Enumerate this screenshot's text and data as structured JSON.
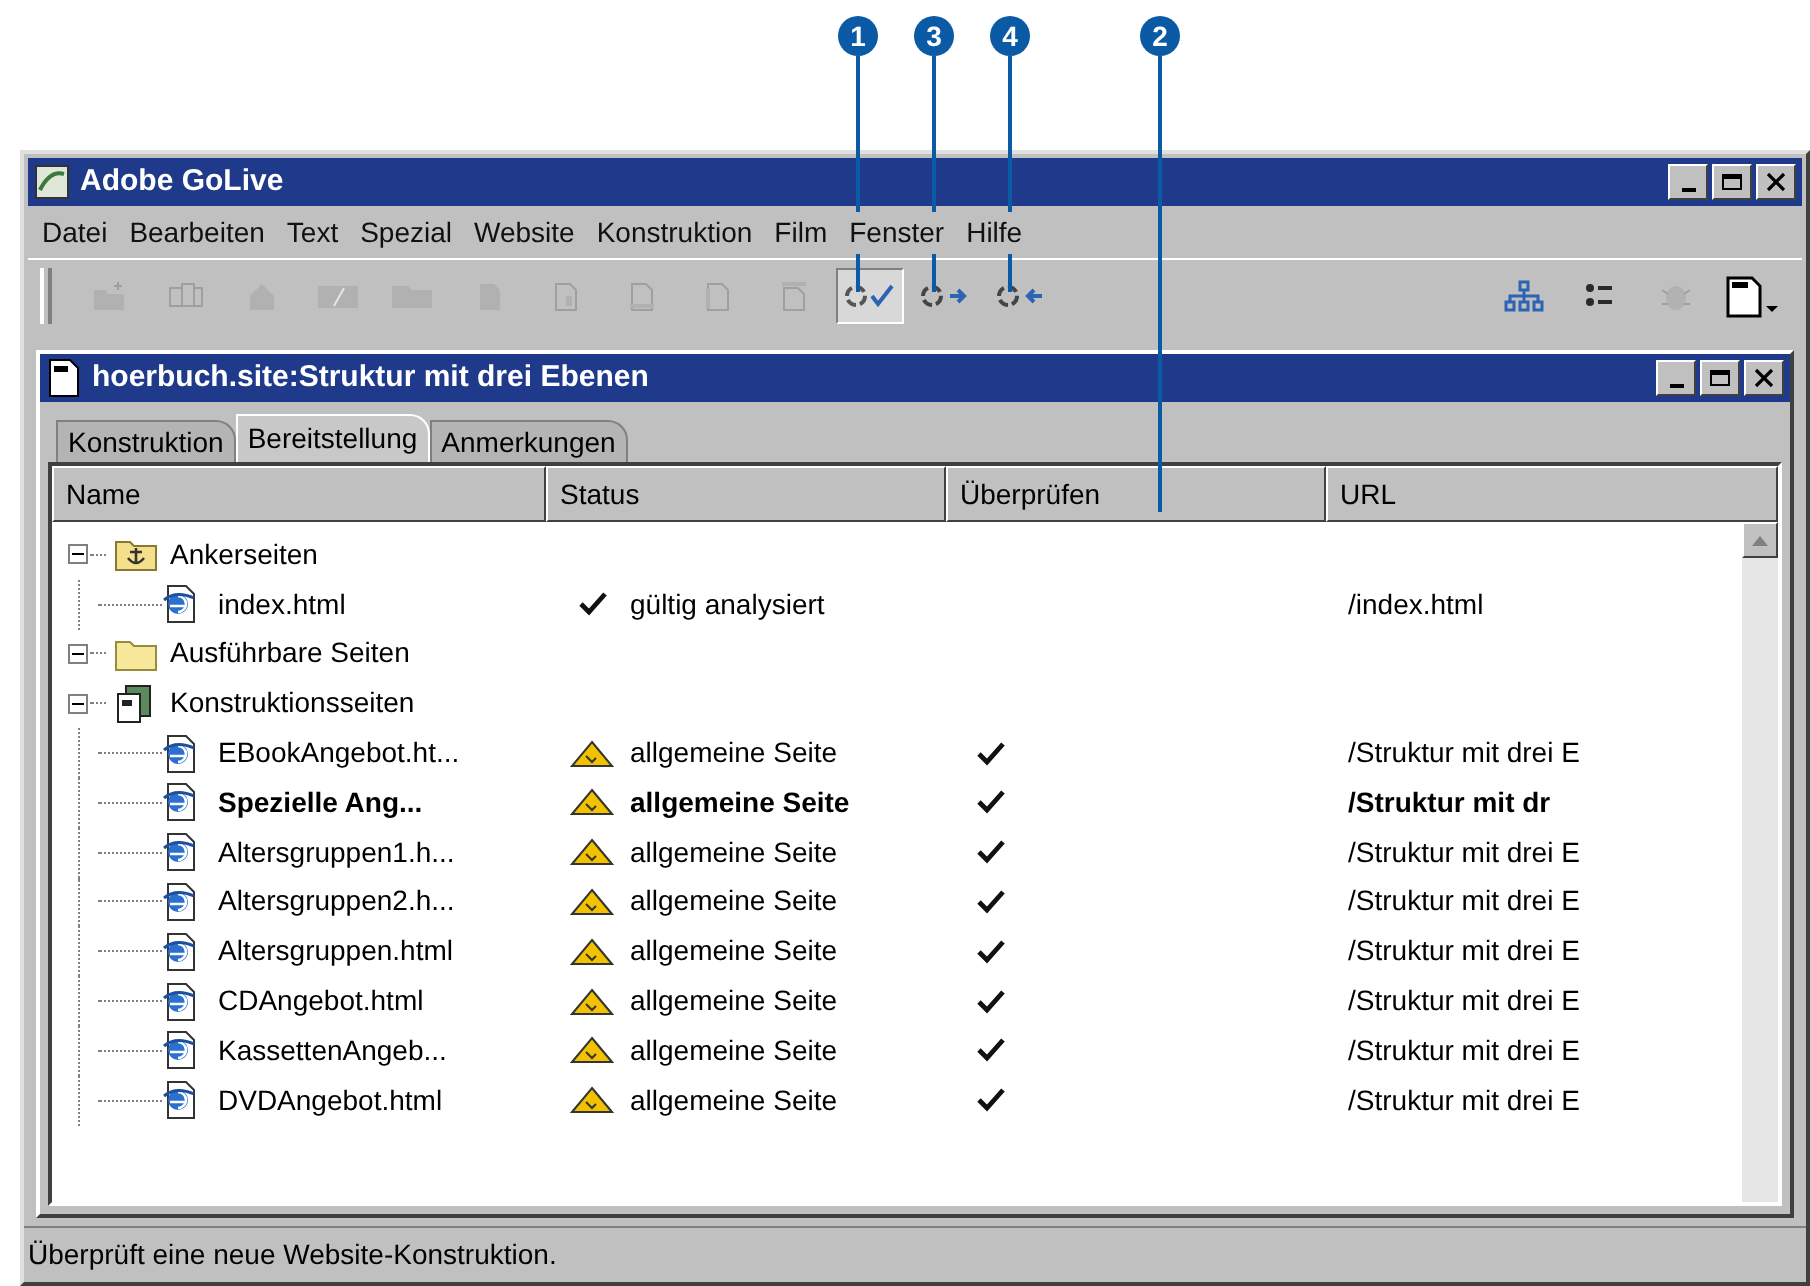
{
  "callouts": [
    {
      "label": "1",
      "kind": "toolbar"
    },
    {
      "label": "3",
      "kind": "toolbar"
    },
    {
      "label": "4",
      "kind": "toolbar"
    },
    {
      "label": "2",
      "kind": "header"
    }
  ],
  "window": {
    "title": "Adobe GoLive"
  },
  "menu": [
    "Datei",
    "Bearbeiten",
    "Text",
    "Spezial",
    "Website",
    "Konstruktion",
    "Film",
    "Fenster",
    "Hilfe"
  ],
  "toolbar": [
    {
      "kind": "folder-new",
      "disabled": true,
      "selected": false
    },
    {
      "kind": "pages",
      "disabled": true,
      "selected": false
    },
    {
      "kind": "home",
      "disabled": true,
      "selected": false
    },
    {
      "kind": "page-edit",
      "disabled": true,
      "selected": false
    },
    {
      "kind": "folders",
      "disabled": true,
      "selected": false
    },
    {
      "kind": "doc",
      "disabled": true,
      "selected": false
    },
    {
      "kind": "doc-split",
      "disabled": true,
      "selected": false
    },
    {
      "kind": "doc-bottom",
      "disabled": true,
      "selected": false
    },
    {
      "kind": "doc-side",
      "disabled": true,
      "selected": false
    },
    {
      "kind": "doc-top",
      "disabled": true,
      "selected": false
    },
    {
      "kind": "sync-check",
      "disabled": false,
      "selected": true
    },
    {
      "kind": "sync-out",
      "disabled": false,
      "selected": false
    },
    {
      "kind": "sync-in",
      "disabled": false,
      "selected": false
    },
    {
      "kind": "spacer"
    },
    {
      "kind": "sitemap",
      "disabled": false,
      "selected": false
    },
    {
      "kind": "list",
      "disabled": false,
      "selected": false
    },
    {
      "kind": "bug",
      "disabled": true,
      "selected": false
    },
    {
      "kind": "doc-menu",
      "disabled": false,
      "selected": false
    }
  ],
  "site_window": {
    "title": "hoerbuch.site:Struktur mit drei Ebenen",
    "tabs": [
      {
        "label": "Konstruktion",
        "selected": false
      },
      {
        "label": "Bereitstellung",
        "selected": true
      },
      {
        "label": "Anmerkungen",
        "selected": false
      }
    ],
    "columns": [
      "Name",
      "Status",
      "Überprüfen",
      "URL"
    ],
    "tree": [
      {
        "name": "Ankerseiten",
        "kind": "anchor-folder",
        "expanded": true,
        "children": [
          {
            "name": "index.html",
            "kind": "page",
            "status": {
              "kind": "valid",
              "text": "gültig analysiert"
            },
            "checked": false,
            "url": "/index.html",
            "bold": false
          }
        ]
      },
      {
        "name": "Ausführbare Seiten",
        "kind": "folder",
        "expanded": true
      },
      {
        "name": "Konstruktionsseiten",
        "kind": "construction",
        "expanded": true,
        "children": [
          {
            "name": "EBookAngebot.ht...",
            "kind": "page",
            "status": {
              "kind": "warning",
              "text": "allgemeine Seite"
            },
            "checked": true,
            "url": "/Struktur mit drei E",
            "bold": false
          },
          {
            "name": "Spezielle Ang...",
            "kind": "page",
            "status": {
              "kind": "warning",
              "text": "allgemeine Seite"
            },
            "checked": true,
            "url": "/Struktur mit dr",
            "bold": true
          },
          {
            "name": "Altersgruppen1.h...",
            "kind": "page",
            "status": {
              "kind": "warning",
              "text": "allgemeine Seite"
            },
            "checked": true,
            "url": "/Struktur mit drei E",
            "bold": false
          },
          {
            "name": "Altersgruppen2.h...",
            "kind": "page",
            "status": {
              "kind": "warning",
              "text": "allgemeine Seite"
            },
            "checked": true,
            "url": "/Struktur mit drei E",
            "bold": false
          },
          {
            "name": "Altersgruppen.html",
            "kind": "page",
            "status": {
              "kind": "warning",
              "text": "allgemeine Seite"
            },
            "checked": true,
            "url": "/Struktur mit drei E",
            "bold": false
          },
          {
            "name": "CDAngebot.html",
            "kind": "page",
            "status": {
              "kind": "warning",
              "text": "allgemeine Seite"
            },
            "checked": true,
            "url": "/Struktur mit drei E",
            "bold": false
          },
          {
            "name": "KassettenAngeb...",
            "kind": "page",
            "status": {
              "kind": "warning",
              "text": "allgemeine Seite"
            },
            "checked": true,
            "url": "/Struktur mit drei E",
            "bold": false
          },
          {
            "name": "DVDAngebot.html",
            "kind": "page",
            "status": {
              "kind": "warning",
              "text": "allgemeine Seite"
            },
            "checked": true,
            "url": "/Struktur mit drei E",
            "bold": false
          }
        ]
      }
    ]
  },
  "status_bar": "Überprüft eine neue Website-Konstruktion."
}
